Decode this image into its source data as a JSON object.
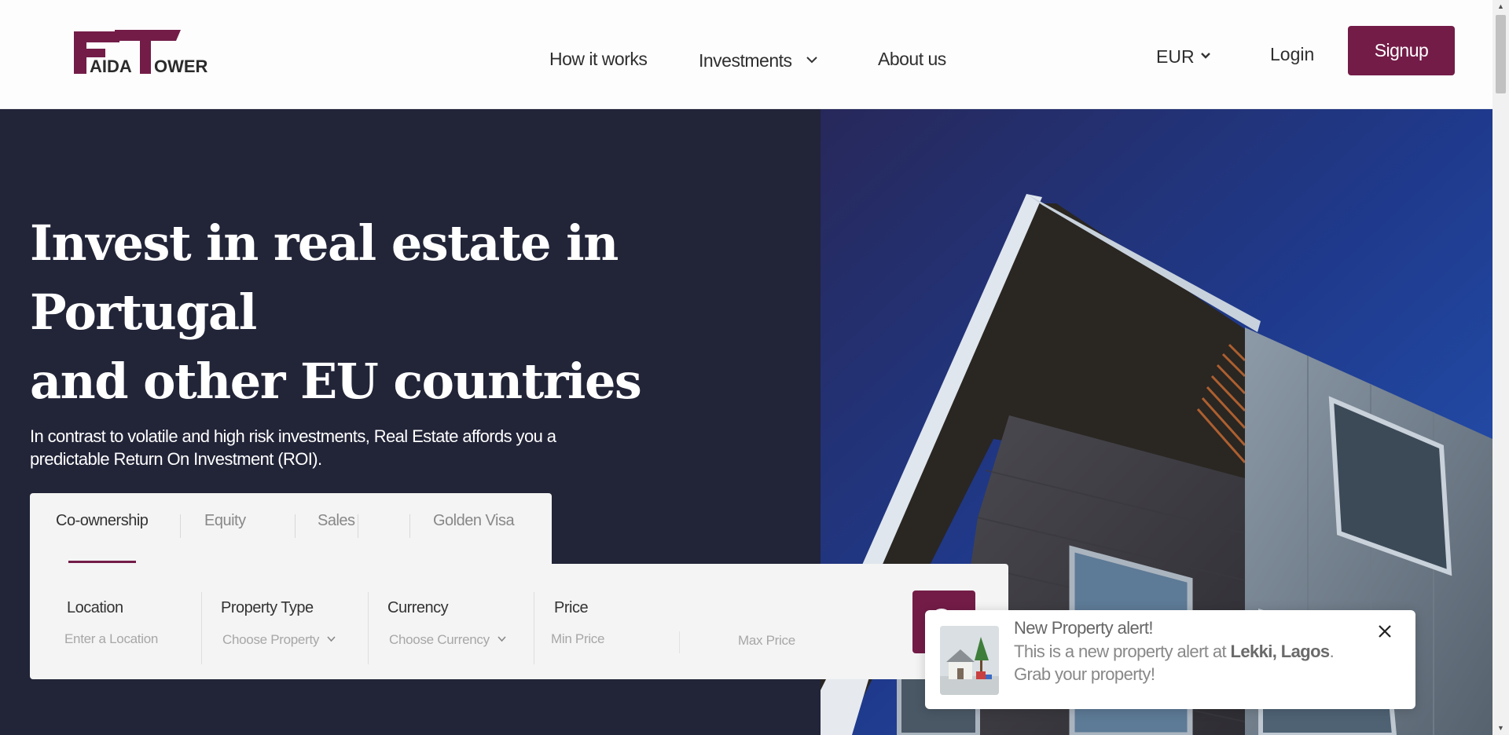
{
  "header": {
    "logo": {
      "letters_big": "FT",
      "word1": "AIDA",
      "word2": "OWER"
    },
    "nav": {
      "how_it_works": "How it works",
      "investments": "Investments",
      "about_us": "About us"
    },
    "currency": "EUR",
    "login": "Login",
    "signup": "Signup",
    "brand_color": "#731c48"
  },
  "hero": {
    "title_line1": "Invest in real estate in Portugal",
    "title_line2": "and other EU countries",
    "subtitle_line1": "In contrast to volatile and high risk investments, Real Estate affords you a",
    "subtitle_line2": "predictable Return On Investment (ROI).",
    "background_color": "#222438"
  },
  "search": {
    "tabs": [
      {
        "label": "Co-ownership",
        "active": true
      },
      {
        "label": "Equity",
        "active": false
      },
      {
        "label": "Sales",
        "active": false
      },
      {
        "label": "Golden Visa",
        "active": false
      }
    ],
    "location": {
      "label": "Location",
      "placeholder": "Enter a Location"
    },
    "property_type": {
      "label": "Property Type",
      "value": "Choose Property"
    },
    "currency": {
      "label": "Currency",
      "value": "Choose Currency"
    },
    "price": {
      "label": "Price",
      "min_placeholder": "Min Price",
      "max_placeholder": "Max Price"
    },
    "search_icon": "search-icon"
  },
  "notification": {
    "title": "New Property alert!",
    "body_prefix": "This is a new property alert at ",
    "body_location": "Lekki, Lagos",
    "body_suffix": ". Grab your property!",
    "image": "house-thumbnail",
    "close_icon": "close-icon"
  }
}
